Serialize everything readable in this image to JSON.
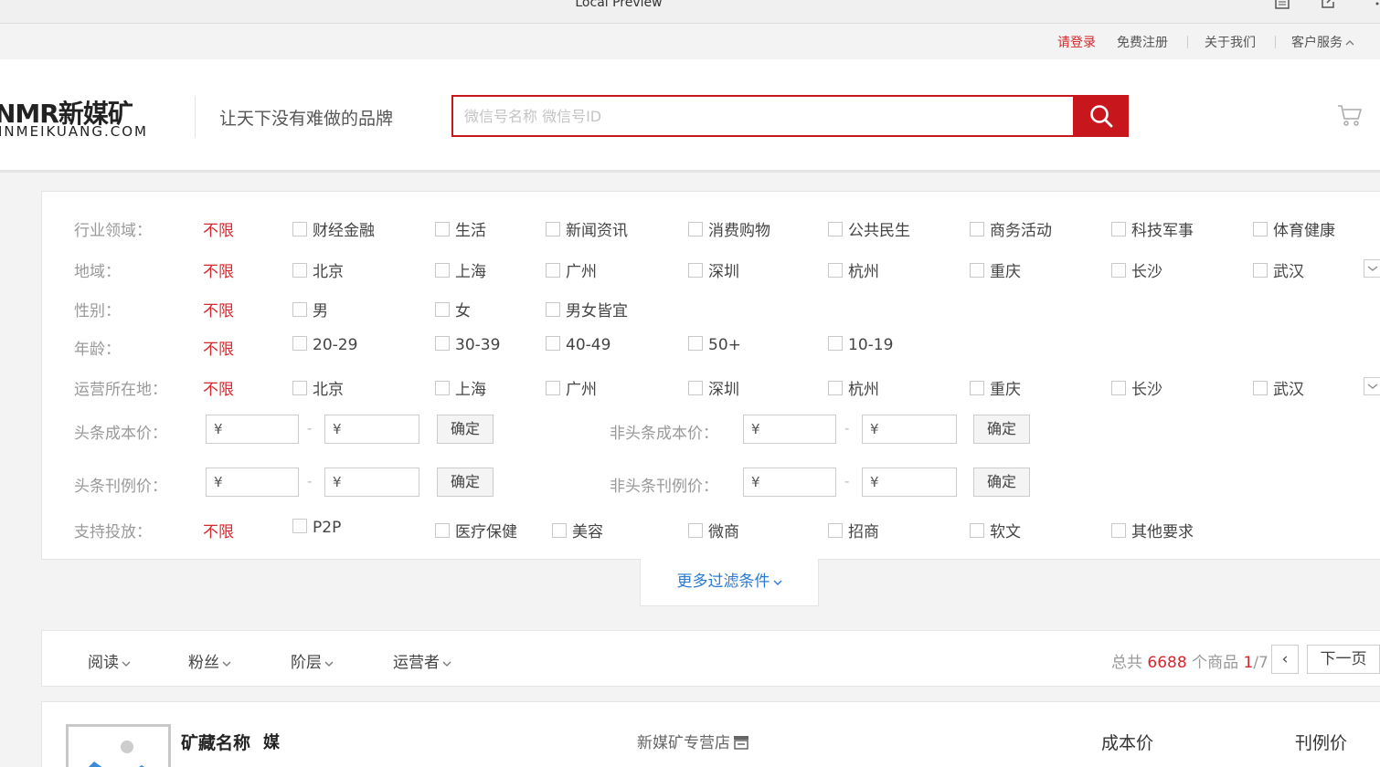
{
  "window": {
    "title": "Local Preview"
  },
  "topbar": {
    "login": "请登录",
    "register": "免费注册",
    "about": "关于我们",
    "service": "客户服务"
  },
  "header": {
    "logo_main": "NMR新媒矿",
    "logo_sub": "INMEIKUANG.COM",
    "slogan": "让天下没有难做的品牌",
    "search_placeholder": "微信号名称 微信号ID"
  },
  "filters": {
    "industry": {
      "label": "行业领域：",
      "unlimited": "不限",
      "options": [
        "财经金融",
        "生活",
        "新闻资讯",
        "消费购物",
        "公共民生",
        "商务活动",
        "科技军事",
        "体育健康"
      ]
    },
    "region": {
      "label": "地域：",
      "unlimited": "不限",
      "options": [
        "北京",
        "上海",
        "广州",
        "深圳",
        "杭州",
        "重庆",
        "长沙",
        "武汉"
      ]
    },
    "gender": {
      "label": "性别：",
      "unlimited": "不限",
      "options": [
        "男",
        "女",
        "男女皆宜"
      ]
    },
    "age": {
      "label": "年龄：",
      "unlimited": "不限",
      "options": [
        "20-29",
        "30-39",
        "40-49",
        "50+",
        "10-19"
      ]
    },
    "operator_location": {
      "label": "运营所在地：",
      "unlimited": "不限",
      "options": [
        "北京",
        "上海",
        "广州",
        "深圳",
        "杭州",
        "重庆",
        "长沙",
        "武汉"
      ]
    },
    "headline_cost": {
      "label": "头条成本价：",
      "from": "¥",
      "to": "¥",
      "confirm": "确定"
    },
    "non_headline_cost": {
      "label": "非头条成本价：",
      "from": "¥",
      "to": "¥",
      "confirm": "确定"
    },
    "headline_rate": {
      "label": "头条刊例价：",
      "from": "¥",
      "to": "¥",
      "confirm": "确定"
    },
    "non_headline_rate": {
      "label": "非头条刊例价：",
      "from": "¥",
      "to": "¥",
      "confirm": "确定"
    },
    "support": {
      "label": "支持投放：",
      "unlimited": "不限",
      "options": [
        "P2P",
        "医疗保健",
        "美容",
        "微商",
        "招商",
        "软文",
        "其他要求"
      ]
    },
    "dash": "-",
    "more": "更多过滤条件"
  },
  "sortbar": {
    "sorts": [
      "阅读",
      "粉丝",
      "阶层",
      "运营者"
    ],
    "total_prefix": "总共",
    "total_count": "6688",
    "total_mid": "个商品",
    "page_current": "1",
    "page_total": "/7",
    "prev": "‹",
    "next": "下一页"
  },
  "product": {
    "name": "矿藏名称",
    "badge": "媒",
    "store": "新媒矿专营店",
    "cost_header": "成本价",
    "rate_header": "刊例价"
  },
  "colors": {
    "brand_red": "#c8161d",
    "link_blue": "#2a7ad2",
    "muted": "#999999"
  },
  "icons": [
    "document-icon",
    "export-icon",
    "more-icon",
    "caret-up-icon",
    "search-icon",
    "cart-icon",
    "chevron-down-icon",
    "store-icon",
    "image-placeholder-icon"
  ]
}
